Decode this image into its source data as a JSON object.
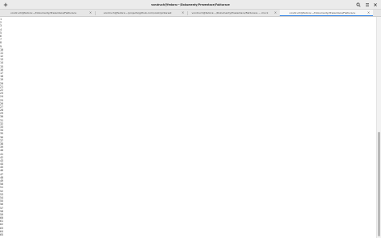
{
  "window": {
    "title": "vondruch@fedora:~/Dokumenty/Prezentace/Fakturace"
  },
  "tabs": [
    {
      "label": "vondruch@fedora:~/Dokumenty/Prezentace/Fakturace",
      "active": false
    },
    {
      "label": "vondruch@fedora:~/projects/github.com/voxik/pinterest",
      "active": false
    },
    {
      "label": "vondruch@fedora:~/Dokumenty/Prezentace/Fakturace — mock",
      "active": false
    },
    {
      "label": "vondruch@fedora:~/Dokumenty/Prezentace/Fakturace",
      "active": true
    }
  ],
  "tab_close_glyph": "×",
  "terminal": {
    "lines": [
      "1",
      "2",
      "3",
      "4",
      "5",
      "6",
      "7",
      "8",
      "9",
      "10",
      "11",
      "12",
      "13",
      "14",
      "15",
      "16",
      "17",
      "18",
      "19",
      "20",
      "21",
      "22",
      "23",
      "24",
      "25",
      "26",
      "27",
      "28",
      "29",
      "30",
      "31",
      "32",
      "33",
      "34",
      "35",
      "36",
      "37",
      "38",
      "39",
      "40",
      "41",
      "42",
      "43",
      "44",
      "45",
      "46",
      "47",
      "48",
      "49",
      "50",
      "51",
      "52",
      "53",
      "54",
      "55",
      "56",
      "57",
      "58",
      "59",
      "60",
      "61",
      "62",
      "63",
      "64",
      "65"
    ]
  },
  "scrollbar": {
    "thumb_start": 0.52,
    "thumb_end": 1.0
  },
  "colors": {
    "accent": "#3584e4",
    "titlebar": "#ebebeb",
    "tabbar": "#e6e6e6"
  }
}
